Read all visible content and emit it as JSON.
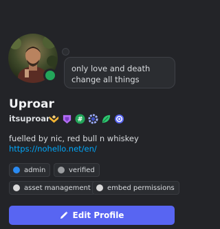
{
  "status_bubble": {
    "line1": "only love and death",
    "line2": "change all things"
  },
  "profile": {
    "display_name": "Uproar",
    "username": "itsuproar",
    "bio_line": "fuelled by nic, red bull n whiskey",
    "link": "https://nohello.net/en/",
    "status": "online",
    "status_color": "#23a55a"
  },
  "badges": [
    {
      "icon": "hypesquad-balance-icon",
      "color": "#f0b232"
    },
    {
      "icon": "nitro-icon",
      "color": "#b36cf4"
    },
    {
      "icon": "active-developer-icon",
      "color": "#23a55a"
    },
    {
      "icon": "server-booster-icon",
      "color": "#a0b0ff"
    },
    {
      "icon": "quest-leaf-icon",
      "color": "#2dc770"
    },
    {
      "icon": "completed-quest-icon",
      "color": "#5865f2"
    }
  ],
  "roles": [
    {
      "label": "admin",
      "color": "#2a8bf2"
    },
    {
      "label": "verified",
      "color": "#9b9da0"
    },
    {
      "label": "asset management",
      "color": "#d9d9d9"
    },
    {
      "label": "embed permissions",
      "color": "#d9d9d9"
    }
  ],
  "actions": {
    "edit_profile": "Edit Profile"
  },
  "colors": {
    "background": "#232428",
    "accent": "#5865f2",
    "link": "#00a8fc"
  }
}
